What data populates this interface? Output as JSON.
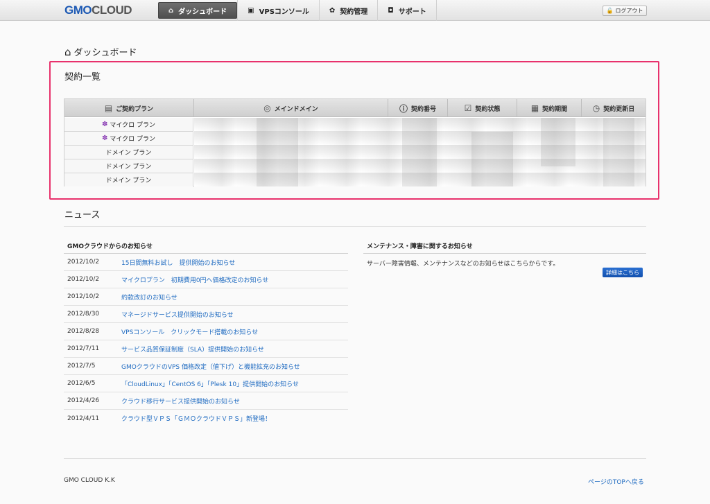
{
  "header": {
    "logo_gmo": "GMO",
    "logo_cloud": "CLOUD",
    "nav": [
      {
        "label": "ダッシュボード",
        "icon": "home-icon"
      },
      {
        "label": "VPSコンソール",
        "icon": "console-icon"
      },
      {
        "label": "契約管理",
        "icon": "gear-icon"
      },
      {
        "label": "サポート",
        "icon": "camera-icon"
      }
    ],
    "logout_label": "ログアウト"
  },
  "page_title": "ダッシュボード",
  "contracts": {
    "title": "契約一覧",
    "columns": [
      "ご契約プラン",
      "メインドメイン",
      "契約番号",
      "契約状態",
      "契約期間",
      "契約更新日"
    ],
    "rows": [
      {
        "plan": "マイクロ プラン",
        "icon": true
      },
      {
        "plan": "マイクロ プラン",
        "icon": true
      },
      {
        "plan": "ドメイン プラン",
        "icon": false
      },
      {
        "plan": "ドメイン プラン",
        "icon": false
      },
      {
        "plan": "ドメイン プラン",
        "icon": false
      }
    ]
  },
  "news": {
    "title": "ニュース",
    "gmo_heading": "GMOクラウドからのお知らせ",
    "items": [
      {
        "date": "2012/10/2",
        "text": "15日間無料お試し　提供開始のお知らせ"
      },
      {
        "date": "2012/10/2",
        "text": "マイクロプラン　初期費用0円へ価格改定のお知らせ"
      },
      {
        "date": "2012/10/2",
        "text": "約款改訂のお知らせ"
      },
      {
        "date": "2012/8/30",
        "text": "マネージドサービス提供開始のお知らせ"
      },
      {
        "date": "2012/8/28",
        "text": "VPSコンソール　クリックモード搭載のお知らせ"
      },
      {
        "date": "2012/7/11",
        "text": "サービス品質保証制度（SLA）提供開始のお知らせ"
      },
      {
        "date": "2012/7/5",
        "text": "GMOクラウドのVPS 価格改定（値下げ）と機能拡充のお知らせ"
      },
      {
        "date": "2012/6/5",
        "text": "「CloudLinux」「CentOS 6」「Plesk 10」提供開始のお知らせ"
      },
      {
        "date": "2012/4/26",
        "text": "クラウド移行サービス提供開始のお知らせ"
      },
      {
        "date": "2012/4/11",
        "text": "クラウド型ＶＰＳ「ＧＭＯクラウドＶＰＳ」新登場！"
      }
    ],
    "maint_heading": "メンテナンス・障害に関するお知らせ",
    "maint_text": "サーバー障害情報、メンテナンスなどのお知らせはこちらからです。",
    "detail_label": "詳細はこちら"
  },
  "footer": {
    "company": "GMO CLOUD K.K",
    "back_to_top": "ページのTOPへ戻る"
  }
}
